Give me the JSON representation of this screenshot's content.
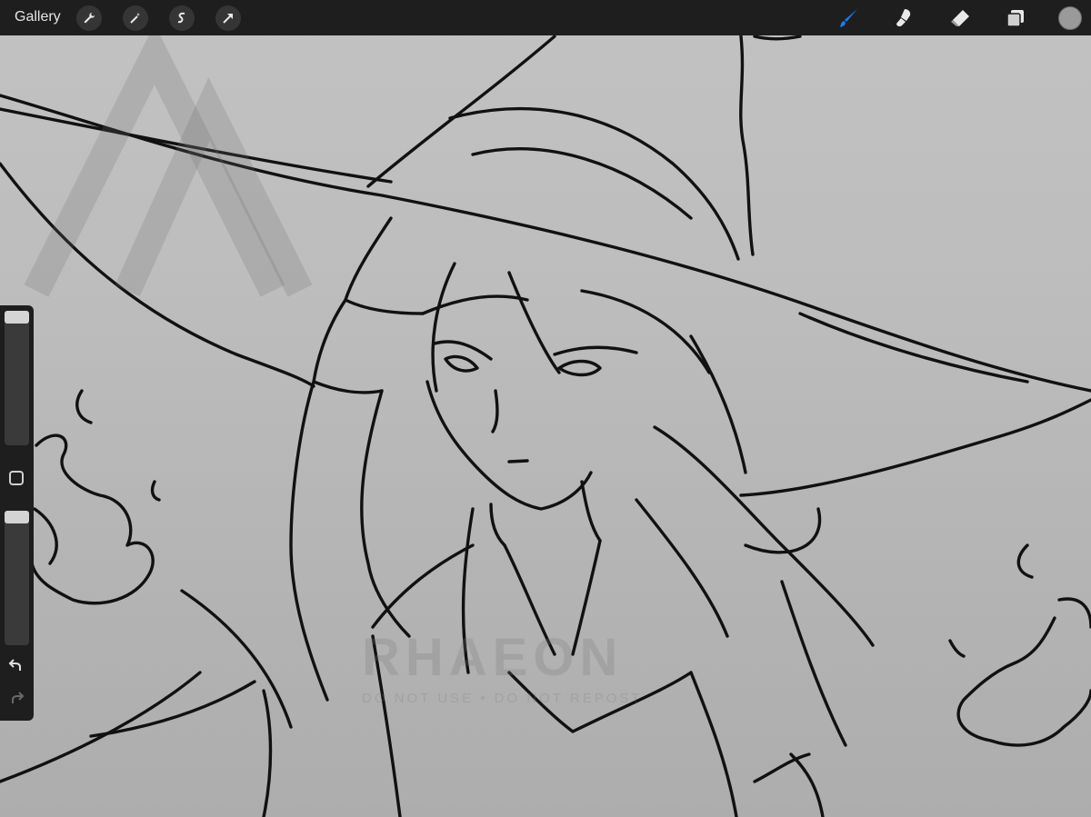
{
  "topbar": {
    "gallery_label": "Gallery",
    "left_tools": [
      "wrench-icon",
      "magic-wand-icon",
      "selection-icon",
      "transform-arrow-icon"
    ],
    "right_tools": [
      "brush-icon",
      "smudge-icon",
      "eraser-icon",
      "layers-icon"
    ],
    "active_tool": "brush-icon",
    "active_color": "#1a7cf5",
    "current_color": "#9a9a9a"
  },
  "sidebar": {
    "brush_size_level": 0.0,
    "opacity_level": 0.0,
    "icons": [
      "modify-icon",
      "undo-icon",
      "redo-icon"
    ]
  },
  "canvas": {
    "subject": "witch line-art sketch",
    "watermark_text": "RHAEON",
    "watermark_subtext": "DO NOT USE • DO NOT REPOST"
  }
}
